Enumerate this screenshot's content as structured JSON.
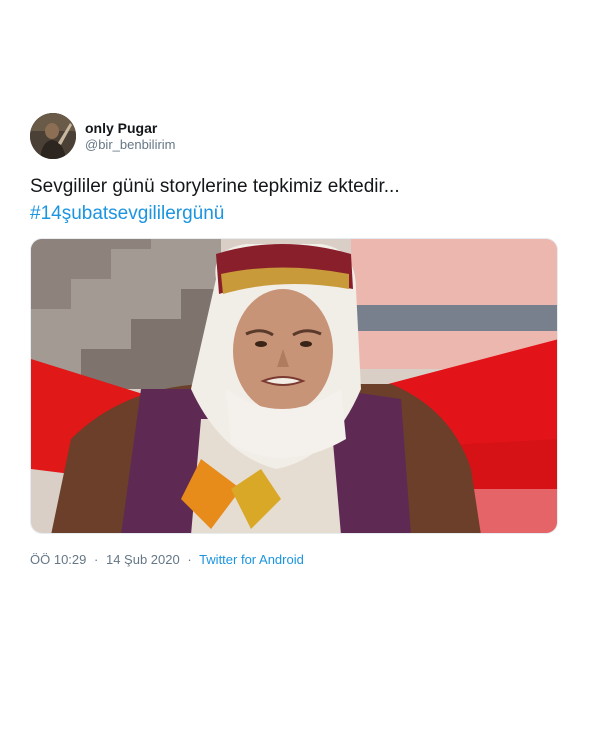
{
  "tweet": {
    "display_name": "only Pugar",
    "handle": "@bir_benbilirim",
    "text": "Sevgililer günü storylerine tepkimiz ektedir...",
    "hashtag": "#14şubatsevgililergünü",
    "time": "ÖÖ 10:29",
    "date": "14 Şub 2020",
    "source": "Twitter for Android",
    "separator": "·"
  },
  "colors": {
    "link": "#1b95e0",
    "secondary_text": "#657786",
    "primary_text": "#14171a"
  },
  "icons": {
    "avatar": "user-avatar-photo",
    "media": "tweet-media-photo"
  }
}
